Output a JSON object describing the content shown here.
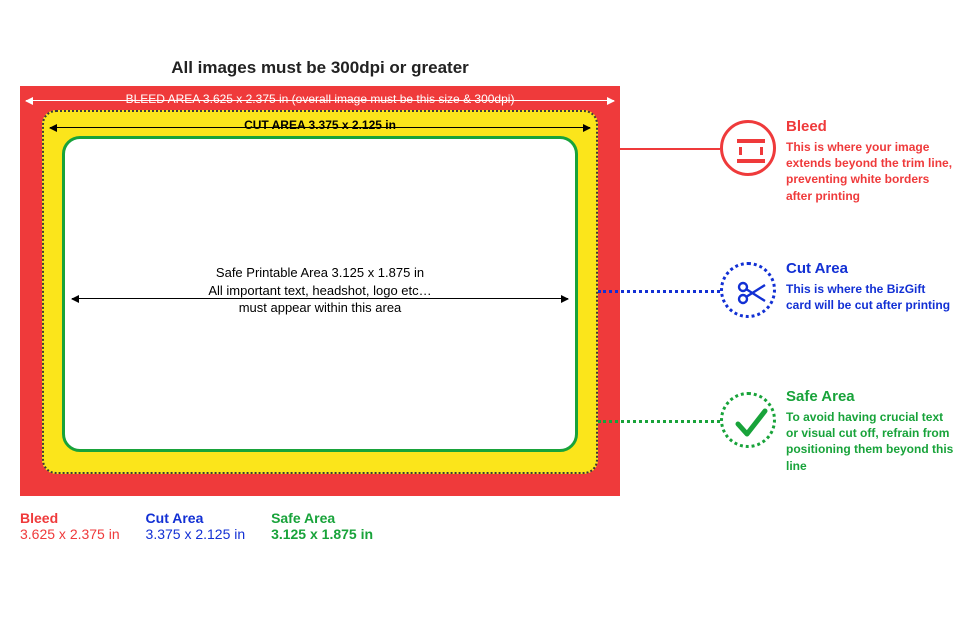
{
  "title": "All images must be 300dpi or greater",
  "diagram": {
    "bleed_label": "BLEED AREA 3.625 x 2.375 in (overall image must be this size & 300dpi)",
    "cut_label": "CUT AREA 3.375 x 2.125 in",
    "safe_line1": "Safe Printable Area 3.125 x 1.875 in",
    "safe_line2": "All important text, headshot, logo etc…",
    "safe_line3": "must appear within this area"
  },
  "legend": {
    "bleed": {
      "title": "Bleed",
      "body": "This is where your image extends beyond the trim line, preventing white borders after printing"
    },
    "cut": {
      "title": "Cut Area",
      "body": "This is where the BizGift card will be cut after printing"
    },
    "safe": {
      "title": "Safe Area",
      "body": "To avoid having crucial text or visual cut off, refrain from positioning them beyond this line"
    }
  },
  "footer": {
    "bleed": {
      "title": "Bleed",
      "dim": "3.625 x 2.375 in"
    },
    "cut": {
      "title": "Cut Area",
      "dim": "3.375 x 2.125 in"
    },
    "safe": {
      "title": "Safe Area",
      "dim": "3.125 x 1.875 in"
    }
  },
  "colors": {
    "bleed": "#ef3a3b",
    "cut": "#1230d4",
    "safe": "#18a33a",
    "cut_bg": "#fbe51b"
  },
  "chart_data": {
    "type": "diagram",
    "unit": "in",
    "dpi_requirement": 300,
    "areas": [
      {
        "name": "Bleed",
        "width": 3.625,
        "height": 2.375,
        "color": "#ef3a3b",
        "note": "overall image must be this size & 300dpi"
      },
      {
        "name": "Cut Area",
        "width": 3.375,
        "height": 2.125,
        "color": "#1230d4"
      },
      {
        "name": "Safe Area",
        "width": 3.125,
        "height": 1.875,
        "color": "#18a33a",
        "note": "All important text, headshot, logo etc must appear within this area"
      }
    ]
  }
}
